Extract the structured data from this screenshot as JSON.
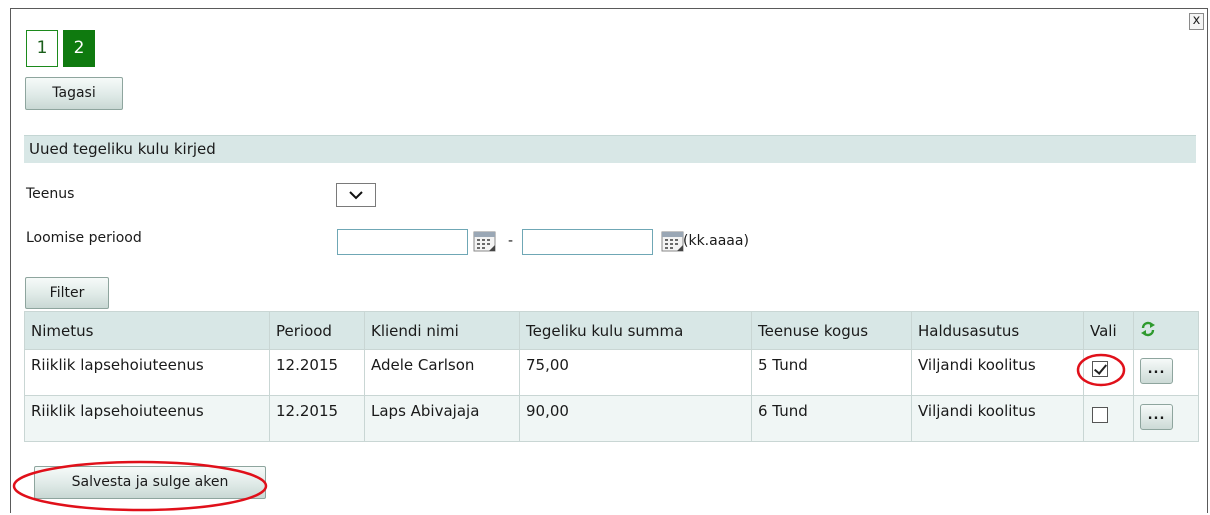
{
  "dialog": {
    "close_label": "x"
  },
  "steps": [
    {
      "label": "1"
    },
    {
      "label": "2"
    }
  ],
  "buttons": {
    "back": "Tagasi",
    "filter": "Filter",
    "save": "Salvesta ja sulge aken",
    "more": "..."
  },
  "section": {
    "title": "Uued tegeliku kulu kirjed"
  },
  "form": {
    "service_label": "Teenus",
    "period_label": "Loomise periood",
    "period_from": "",
    "period_to": "",
    "separator": "-",
    "format_hint": "(kk.aaaa)"
  },
  "table": {
    "headers": [
      "Nimetus",
      "Periood",
      "Kliendi nimi",
      "Tegeliku kulu summa",
      "Teenuse kogus",
      "Haldusasutus",
      "Vali"
    ],
    "rows": [
      {
        "name": "Riiklik lapsehoiuteenus",
        "period": "12.2015",
        "client": "Adele Carlson",
        "amount": "75,00",
        "quantity": "5 Tund",
        "institution": "Viljandi koolitus",
        "selected": true
      },
      {
        "name": "Riiklik lapsehoiuteenus",
        "period": "12.2015",
        "client": "Laps Abivajaja",
        "amount": "90,00",
        "quantity": "6 Tund",
        "institution": "Viljandi koolitus",
        "selected": false
      }
    ]
  },
  "colors": {
    "accent_green": "#0f7a0f",
    "header_bg": "#d8e7e6",
    "annotation_red": "#e0101a"
  },
  "icons": {
    "refresh": "refresh-icon",
    "calendar": "calendar-icon",
    "dropdown": "chevron-down-icon"
  }
}
